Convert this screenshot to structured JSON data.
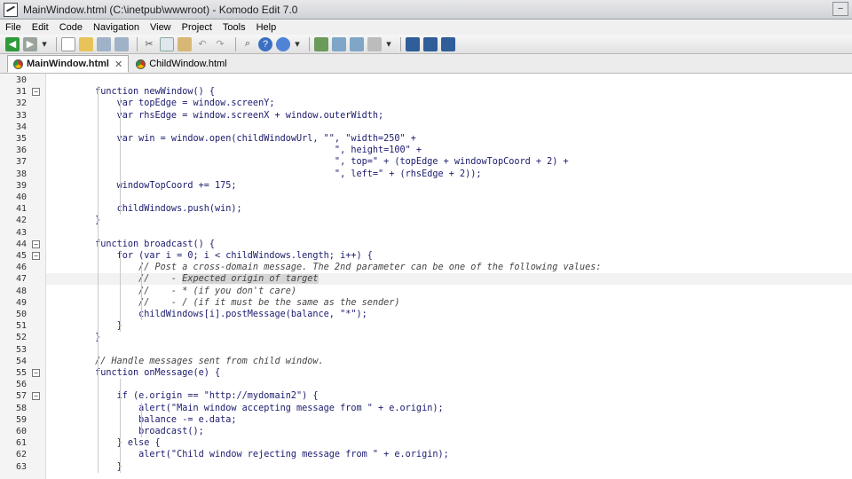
{
  "window": {
    "title": "MainWindow.html (C:\\inetpub\\wwwroot) - Komodo Edit 7.0"
  },
  "menu": [
    "File",
    "Edit",
    "Code",
    "Navigation",
    "View",
    "Project",
    "Tools",
    "Help"
  ],
  "toolbar_icons": [
    "back-icon",
    "forward-icon",
    "dropdown-icon",
    "new-file-icon",
    "open-file-icon",
    "save-icon",
    "save-all-icon",
    "cut-icon",
    "copy-icon",
    "paste-icon",
    "undo-icon",
    "redo-icon",
    "find-icon",
    "help-icon",
    "browser-icon",
    "preview-icon",
    "toggle-panel-icon",
    "toggle-panel-2-icon",
    "toggle-panel-3-icon",
    "toolbox-icon",
    "debug-icon",
    "run-icon",
    "refresh-icon"
  ],
  "tabs": [
    {
      "label": "MainWindow.html",
      "active": true
    },
    {
      "label": "ChildWindow.html",
      "active": false
    }
  ],
  "editor": {
    "lines": [
      {
        "n": "30",
        "text": ""
      },
      {
        "n": "31",
        "text": "        function newWindow() {",
        "fold": true
      },
      {
        "n": "32",
        "text": "            var topEdge = window.screenY;"
      },
      {
        "n": "33",
        "text": "            var rhsEdge = window.screenX + window.outerWidth;"
      },
      {
        "n": "34",
        "text": ""
      },
      {
        "n": "35",
        "text": "            var win = window.open(childWindowUrl, \"\", \"width=250\" +"
      },
      {
        "n": "36",
        "text": "                                                    \", height=100\" +"
      },
      {
        "n": "37",
        "text": "                                                    \", top=\" + (topEdge + windowTopCoord + 2) +"
      },
      {
        "n": "38",
        "text": "                                                    \", left=\" + (rhsEdge + 2));"
      },
      {
        "n": "39",
        "text": "            windowTopCoord += 175;"
      },
      {
        "n": "40",
        "text": ""
      },
      {
        "n": "41",
        "text": "            childWindows.push(win);"
      },
      {
        "n": "42",
        "text": "        }"
      },
      {
        "n": "43",
        "text": ""
      },
      {
        "n": "44",
        "text": "        function broadcast() {",
        "fold": true
      },
      {
        "n": "45",
        "text": "            for (var i = 0; i < childWindows.length; i++) {",
        "fold": true
      },
      {
        "n": "46",
        "text": "                // Post a cross-domain message. The 2nd parameter can be one of the following values:",
        "comment": true
      },
      {
        "n": "47",
        "text": "                //    - Expected origin of target",
        "comment": true,
        "current": true
      },
      {
        "n": "48",
        "text": "                //    - * (if you don't care)",
        "comment": true
      },
      {
        "n": "49",
        "text": "                //    - / (if it must be the same as the sender)",
        "comment": true
      },
      {
        "n": "50",
        "text": "                childWindows[i].postMessage(balance, \"*\");"
      },
      {
        "n": "51",
        "text": "            }"
      },
      {
        "n": "52",
        "text": "        }"
      },
      {
        "n": "53",
        "text": ""
      },
      {
        "n": "54",
        "text": "        // Handle messages sent from child window.",
        "comment": true
      },
      {
        "n": "55",
        "text": "        function onMessage(e) {",
        "fold": true
      },
      {
        "n": "56",
        "text": ""
      },
      {
        "n": "57",
        "text": "            if (e.origin == \"http://mydomain2\") {",
        "fold": true
      },
      {
        "n": "58",
        "text": "                alert(\"Main window accepting message from \" + e.origin);"
      },
      {
        "n": "59",
        "text": "                balance -= e.data;"
      },
      {
        "n": "60",
        "text": "                broadcast();"
      },
      {
        "n": "61",
        "text": "            } else {"
      },
      {
        "n": "62",
        "text": "                alert(\"Child window rejecting message from \" + e.origin);"
      },
      {
        "n": "63",
        "text": "            }"
      }
    ]
  },
  "colors": {
    "code": "#1a1a6e",
    "comment": "#444444",
    "gutter": "#f4f4f4"
  }
}
